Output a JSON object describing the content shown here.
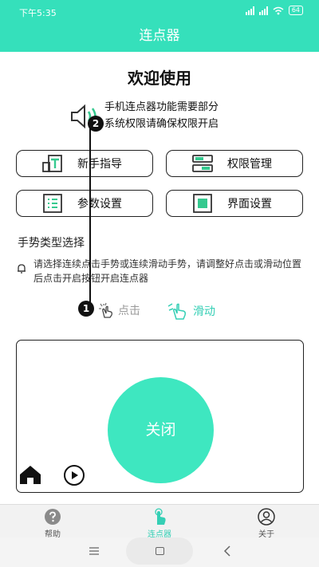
{
  "status_bar": {
    "time": "下午5:35",
    "battery": "64"
  },
  "header": {
    "title": "连点器"
  },
  "welcome": "欢迎使用",
  "notice": {
    "line1": "手机连点器功能需要部分",
    "line2": "系统权限请确保权限开启"
  },
  "cards": {
    "guide": "新手指导",
    "permission": "权限管理",
    "params": "参数设置",
    "interface": "界面设置"
  },
  "gesture_section": {
    "title": "手势类型选择",
    "hint": "请选择连续点击手势或连续滑动手势，请调整好点击或滑动位置后点击开启按钮开启连点器",
    "click_label": "点击",
    "slide_label": "滑动"
  },
  "panel": {
    "toggle_label": "关闭"
  },
  "markers": {
    "one": "1",
    "two": "2"
  },
  "tabs": [
    {
      "label": "帮助"
    },
    {
      "label": "连点器"
    },
    {
      "label": "关于"
    }
  ],
  "colors": {
    "accent": "#35e0bb",
    "button": "#3ee7c0"
  }
}
